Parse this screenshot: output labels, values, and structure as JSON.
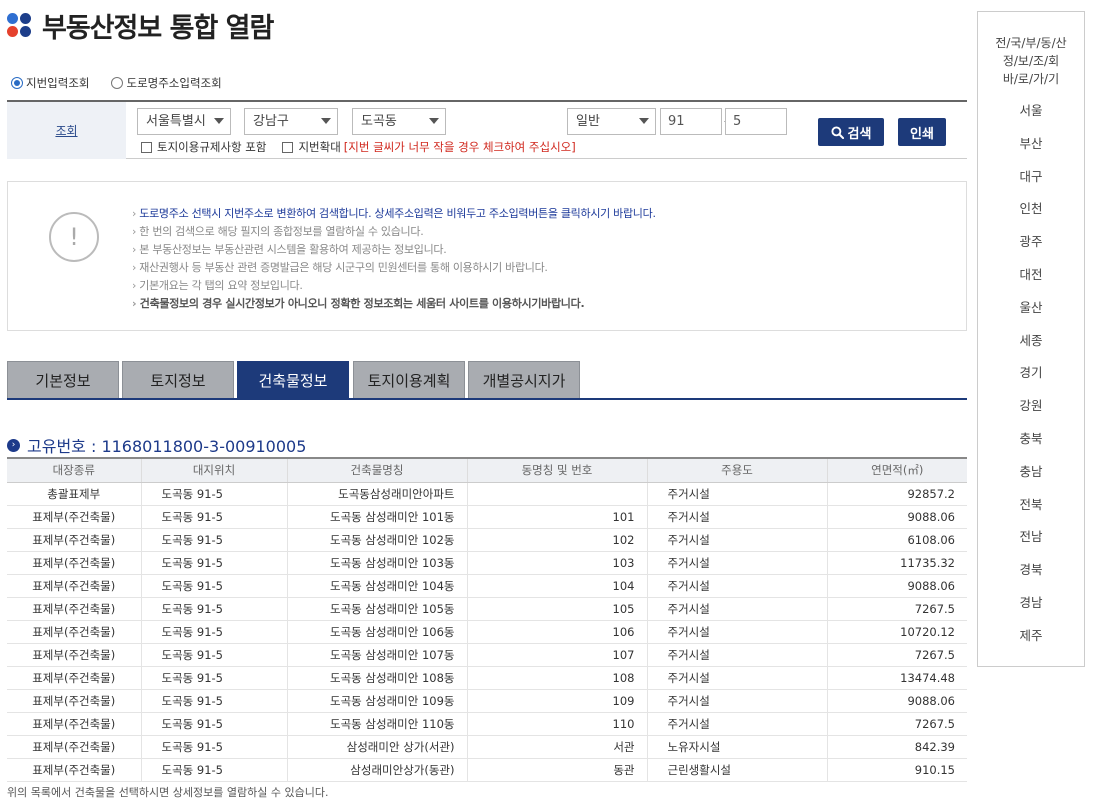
{
  "header": {
    "title": "부동산정보 통합 열람"
  },
  "search_mode": {
    "options": [
      {
        "label": "지번입력조회",
        "selected": true
      },
      {
        "label": "도로명주소입력조회",
        "selected": false
      }
    ]
  },
  "search": {
    "label": "조회",
    "city": "서울특별시",
    "district": "강남구",
    "dong": "도곡동",
    "lot_type": "일반",
    "main_no": "91",
    "sub_no": "5",
    "dash": "-",
    "search_button": "검색",
    "print_button": "인쇄",
    "checkbox_land": "토지이용규제사항 포함",
    "checkbox_zoom": "지번확대",
    "zoom_hint": "[지번 글씨가 너무 작을 경우 체크하여 주십시오]"
  },
  "notice": {
    "icon_text": "!",
    "lines": [
      "도로명주소 선택시 지번주소로 변환하여 검색합니다. 상세주소입력은 비워두고 주소입력버튼을 클릭하시기 바랍니다.",
      "한 번의 검색으로 해당 필지의 종합정보를 열람하실 수 있습니다.",
      "본 부동산정보는 부동산관련 시스템을 활용하여 제공하는 정보입니다.",
      "재산권행사 등 부동산 관련 증명발급은 해당 시군구의 민원센터를 통해 이용하시기 바랍니다.",
      "기본개요는 각 탭의 요약 정보입니다.",
      "건축물정보의 경우 실시간정보가 아니오니 정확한 정보조회는 세움터 사이트를 이용하시기바랍니다."
    ]
  },
  "tabs": [
    {
      "label": "기본정보",
      "active": false
    },
    {
      "label": "토지정보",
      "active": false
    },
    {
      "label": "건축물정보",
      "active": true
    },
    {
      "label": "토지이용계획",
      "active": false
    },
    {
      "label": "개별공시지가",
      "active": false
    }
  ],
  "unique_id": {
    "text": "고유번호 : 1168011800-3-00910005"
  },
  "table": {
    "headers": [
      "대장종류",
      "대지위치",
      "건축물명칭",
      "동명칭 및 번호",
      "주용도",
      "연면적(㎡)"
    ],
    "rows": [
      [
        "총괄표제부",
        "도곡동 91-5",
        "도곡동삼성래미안아파트",
        "",
        "주거시설",
        "92857.2"
      ],
      [
        "표제부(주건축물)",
        "도곡동 91-5",
        "도곡동 삼성래미안 101동",
        "101",
        "주거시설",
        "9088.06"
      ],
      [
        "표제부(주건축물)",
        "도곡동 91-5",
        "도곡동 삼성래미안 102동",
        "102",
        "주거시설",
        "6108.06"
      ],
      [
        "표제부(주건축물)",
        "도곡동 91-5",
        "도곡동 삼성래미안 103동",
        "103",
        "주거시설",
        "11735.32"
      ],
      [
        "표제부(주건축물)",
        "도곡동 91-5",
        "도곡동 삼성래미안 104동",
        "104",
        "주거시설",
        "9088.06"
      ],
      [
        "표제부(주건축물)",
        "도곡동 91-5",
        "도곡동 삼성래미안 105동",
        "105",
        "주거시설",
        "7267.5"
      ],
      [
        "표제부(주건축물)",
        "도곡동 91-5",
        "도곡동 삼성래미안 106동",
        "106",
        "주거시설",
        "10720.12"
      ],
      [
        "표제부(주건축물)",
        "도곡동 91-5",
        "도곡동 삼성래미안 107동",
        "107",
        "주거시설",
        "7267.5"
      ],
      [
        "표제부(주건축물)",
        "도곡동 91-5",
        "도곡동 삼성래미안 108동",
        "108",
        "주거시설",
        "13474.48"
      ],
      [
        "표제부(주건축물)",
        "도곡동 91-5",
        "도곡동 삼성래미안 109동",
        "109",
        "주거시설",
        "9088.06"
      ],
      [
        "표제부(주건축물)",
        "도곡동 91-5",
        "도곡동 삼성래미안 110동",
        "110",
        "주거시설",
        "7267.5"
      ],
      [
        "표제부(주건축물)",
        "도곡동 91-5",
        "삼성래미안 상가(서관)",
        "서관",
        "노유자시설",
        "842.39"
      ],
      [
        "표제부(주건축물)",
        "도곡동 91-5",
        "삼성래미안상가(동관)",
        "동관",
        "근린생활시설",
        "910.15"
      ]
    ]
  },
  "footnote": "위의 목록에서 건축물을 선택하시면 상세정보를 열람하실 수 있습니다.",
  "sidebar": {
    "title_lines": [
      "전/국/부/동/산",
      "정/보/조/회",
      "바/로/가/기"
    ],
    "regions": [
      "서울",
      "부산",
      "대구",
      "인천",
      "광주",
      "대전",
      "울산",
      "세종",
      "경기",
      "강원",
      "충북",
      "충남",
      "전북",
      "전남",
      "경북",
      "경남",
      "제주"
    ]
  },
  "colors": {
    "accent": "#1d3a7a",
    "tab_inactive": "#a9acb1",
    "warning": "#d0271d"
  }
}
